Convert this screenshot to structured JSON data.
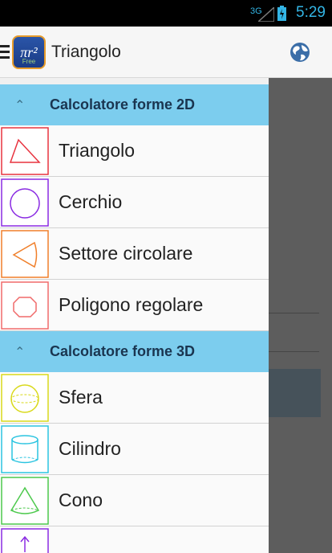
{
  "status_bar": {
    "network": "3G",
    "time": "5:29"
  },
  "action_bar": {
    "title": "Triangolo",
    "logo_text": "πr²",
    "logo_sub": "Free"
  },
  "drawer": {
    "groups": [
      {
        "label": "Calcolatore forme 2D",
        "items": [
          {
            "label": "Triangolo",
            "icon": "triangle-icon",
            "color": "#e8333f"
          },
          {
            "label": "Cerchio",
            "icon": "circle-icon",
            "color": "#8a2be2"
          },
          {
            "label": "Settore circolare",
            "icon": "circular-sector-icon",
            "color": "#f07f2a"
          },
          {
            "label": "Poligono regolare",
            "icon": "regular-polygon-icon",
            "color": "#f06a6a"
          }
        ]
      },
      {
        "label": "Calcolatore forme 3D",
        "items": [
          {
            "label": "Sfera",
            "icon": "sphere-icon",
            "color": "#d9d91a"
          },
          {
            "label": "Cilindro",
            "icon": "cylinder-icon",
            "color": "#2bc4e0"
          },
          {
            "label": "Cono",
            "icon": "cone-icon",
            "color": "#4cc94c"
          },
          {
            "label": "",
            "icon": "arrow-up-icon",
            "color": "#8a2be2"
          }
        ]
      }
    ]
  }
}
